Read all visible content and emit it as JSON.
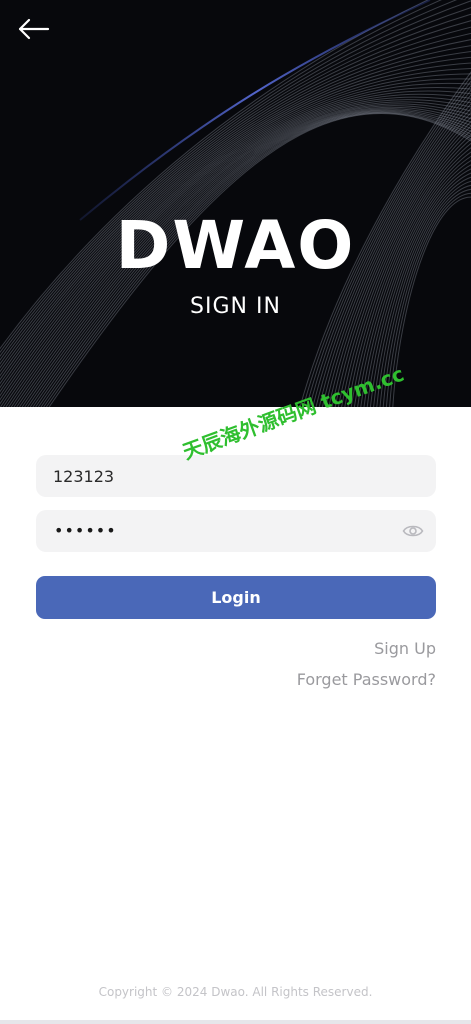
{
  "header": {
    "back_icon": "arrow-left-icon",
    "brand": "DWAO",
    "subtitle": "SIGN IN"
  },
  "form": {
    "username_value": "123123",
    "password_masked": "••••••",
    "password_toggle_icon": "eye-icon",
    "login_label": "Login",
    "signup_label": "Sign Up",
    "forgot_label": "Forget Password?"
  },
  "watermark": "天辰海外源码网 tcym.cc",
  "footer": {
    "copyright": "Copyright © 2024 Dwao. All Rights Reserved."
  },
  "colors": {
    "hero_background": "#07080c",
    "accent": "#4a68b8",
    "field_background": "#f3f3f4",
    "link": "#9a9a9e",
    "watermark": "#2fbf2f"
  }
}
